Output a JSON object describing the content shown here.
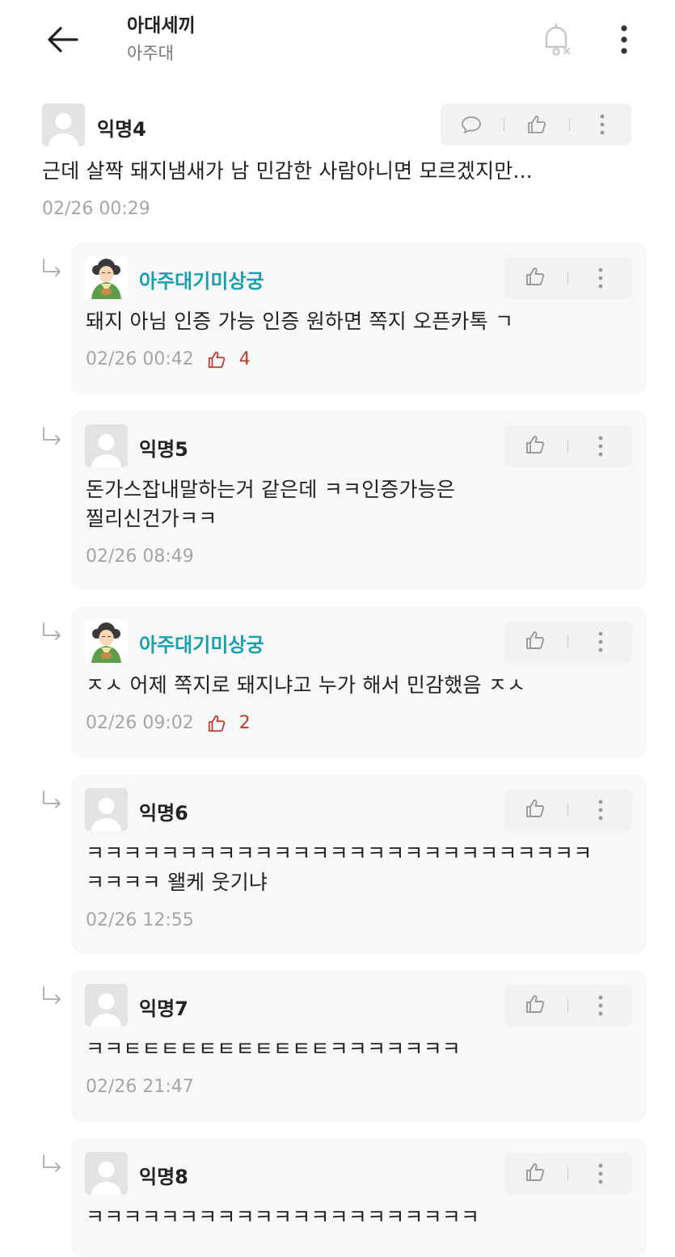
{
  "header": {
    "title": "아대세끼",
    "subtitle": "아주대",
    "icons": {
      "back": "arrow-left-icon",
      "bell": "bell-off-icon",
      "more": "more-vertical-icon"
    }
  },
  "colors": {
    "op_name": "#1b9fb0",
    "like_count": "#c0392b",
    "timestamp": "#a6a6a6",
    "reply_bg": "#f8f8f8"
  },
  "comment": {
    "author": "익명4",
    "text": "근데 살짝 돼지냄새가 남 민감한 사람아니면 모르겠지만...",
    "time": "02/26 00:29"
  },
  "replies": [
    {
      "author": "아주대기미상궁",
      "op": true,
      "lines": [
        "돼지 아님 인증 가능 인증 원하면 쪽지 오픈카톡 ㄱ"
      ],
      "time": "02/26 00:42",
      "likes": "4"
    },
    {
      "author": "익명5",
      "op": false,
      "lines": [
        "돈가스잡내말하는거 같은데 ㅋㅋ인증가능은",
        "찔리신건가ㅋㅋ"
      ],
      "time": "02/26 08:49",
      "likes": ""
    },
    {
      "author": "아주대기미상궁",
      "op": true,
      "lines": [
        "ㅈㅅ 어제 쪽지로 돼지냐고 누가 해서 민감했음 ㅈㅅ"
      ],
      "time": "02/26 09:02",
      "likes": "2"
    },
    {
      "author": "익명6",
      "op": false,
      "lines": [
        "ㅋㅋㅋㅋㅋㅋㅋㅋㅋㅋㅋㅋㅋㅋㅋㅋㅋㅋㅋㅋㅋㅋㅋㅋㅋㅋㅋ",
        "ㅋㅋㅋㅋ 왤케 웃기냐"
      ],
      "time": "02/26 12:55",
      "likes": ""
    },
    {
      "author": "익명7",
      "op": false,
      "lines": [
        "ㅋㅋㅌㅌㅌㅌㅌㅌㅌㅌㅌㅌㅌㅋㅋㅋㅋㅋㅋㅋ"
      ],
      "time": "02/26 21:47",
      "likes": ""
    },
    {
      "author": "익명8",
      "op": false,
      "lines": [
        "ㅋㅋㅋㅋㅋㅋㅋㅋㅋㅋㅋㅋㅋㅋㅋㅋㅋㅋㅋㅋㅋ"
      ],
      "time": "",
      "likes": ""
    }
  ]
}
